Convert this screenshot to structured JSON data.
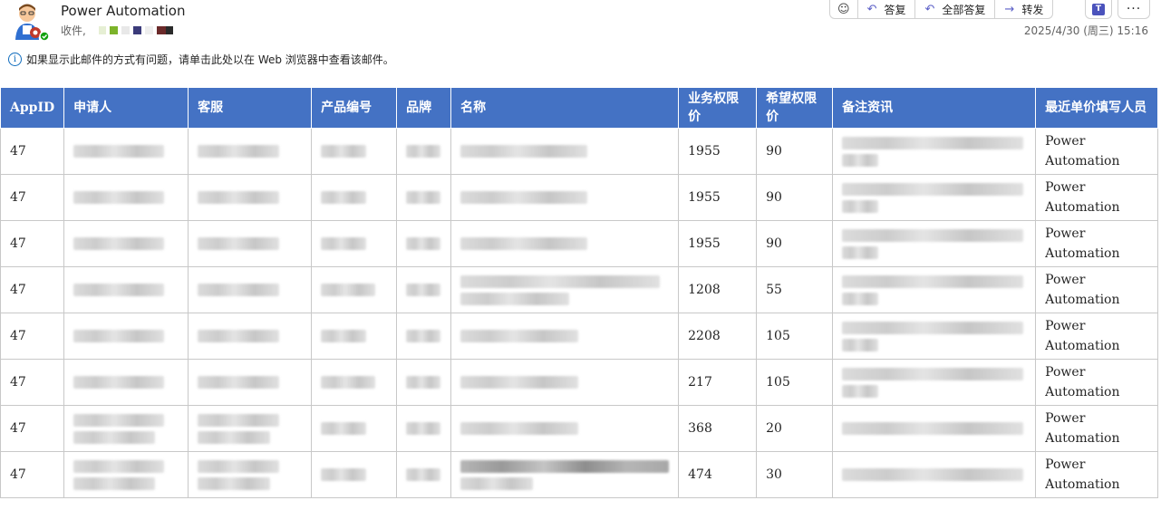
{
  "sender": {
    "name": "Power Automation",
    "to_label": "收件,"
  },
  "toolbar": {
    "reply": "答复",
    "reply_all": "全部答复",
    "forward": "转发"
  },
  "datetime": "2025/4/30 (周三) 15:16",
  "info_message": "如果显示此邮件的方式有问题，请单击此处以在 Web 浏览器中查看该邮件。",
  "colors": {
    "header_bg": "#4472c4",
    "accent": "#5b5fc7"
  },
  "table": {
    "headers": [
      "AppID",
      "申请人",
      "客服",
      "产品编号",
      "品牌",
      "名称",
      "业务权限价",
      "希望权限价",
      "备注资讯",
      "最近单价填写人员"
    ],
    "rows": [
      {
        "appid": "47",
        "biz_price": "1955",
        "hope_price": "90",
        "filler": "Power Automation"
      },
      {
        "appid": "47",
        "biz_price": "1955",
        "hope_price": "90",
        "filler": "Power Automation"
      },
      {
        "appid": "47",
        "biz_price": "1955",
        "hope_price": "90",
        "filler": "Power Automation"
      },
      {
        "appid": "47",
        "biz_price": "1208",
        "hope_price": "55",
        "filler": "Power Automation"
      },
      {
        "appid": "47",
        "biz_price": "2208",
        "hope_price": "105",
        "filler": "Power Automation"
      },
      {
        "appid": "47",
        "biz_price": "217",
        "hope_price": "105",
        "filler": "Power Automation"
      },
      {
        "appid": "47",
        "biz_price": "368",
        "hope_price": "20",
        "filler": "Power Automation"
      },
      {
        "appid": "47",
        "biz_price": "474",
        "hope_price": "30",
        "filler": "Power Automation"
      }
    ]
  }
}
